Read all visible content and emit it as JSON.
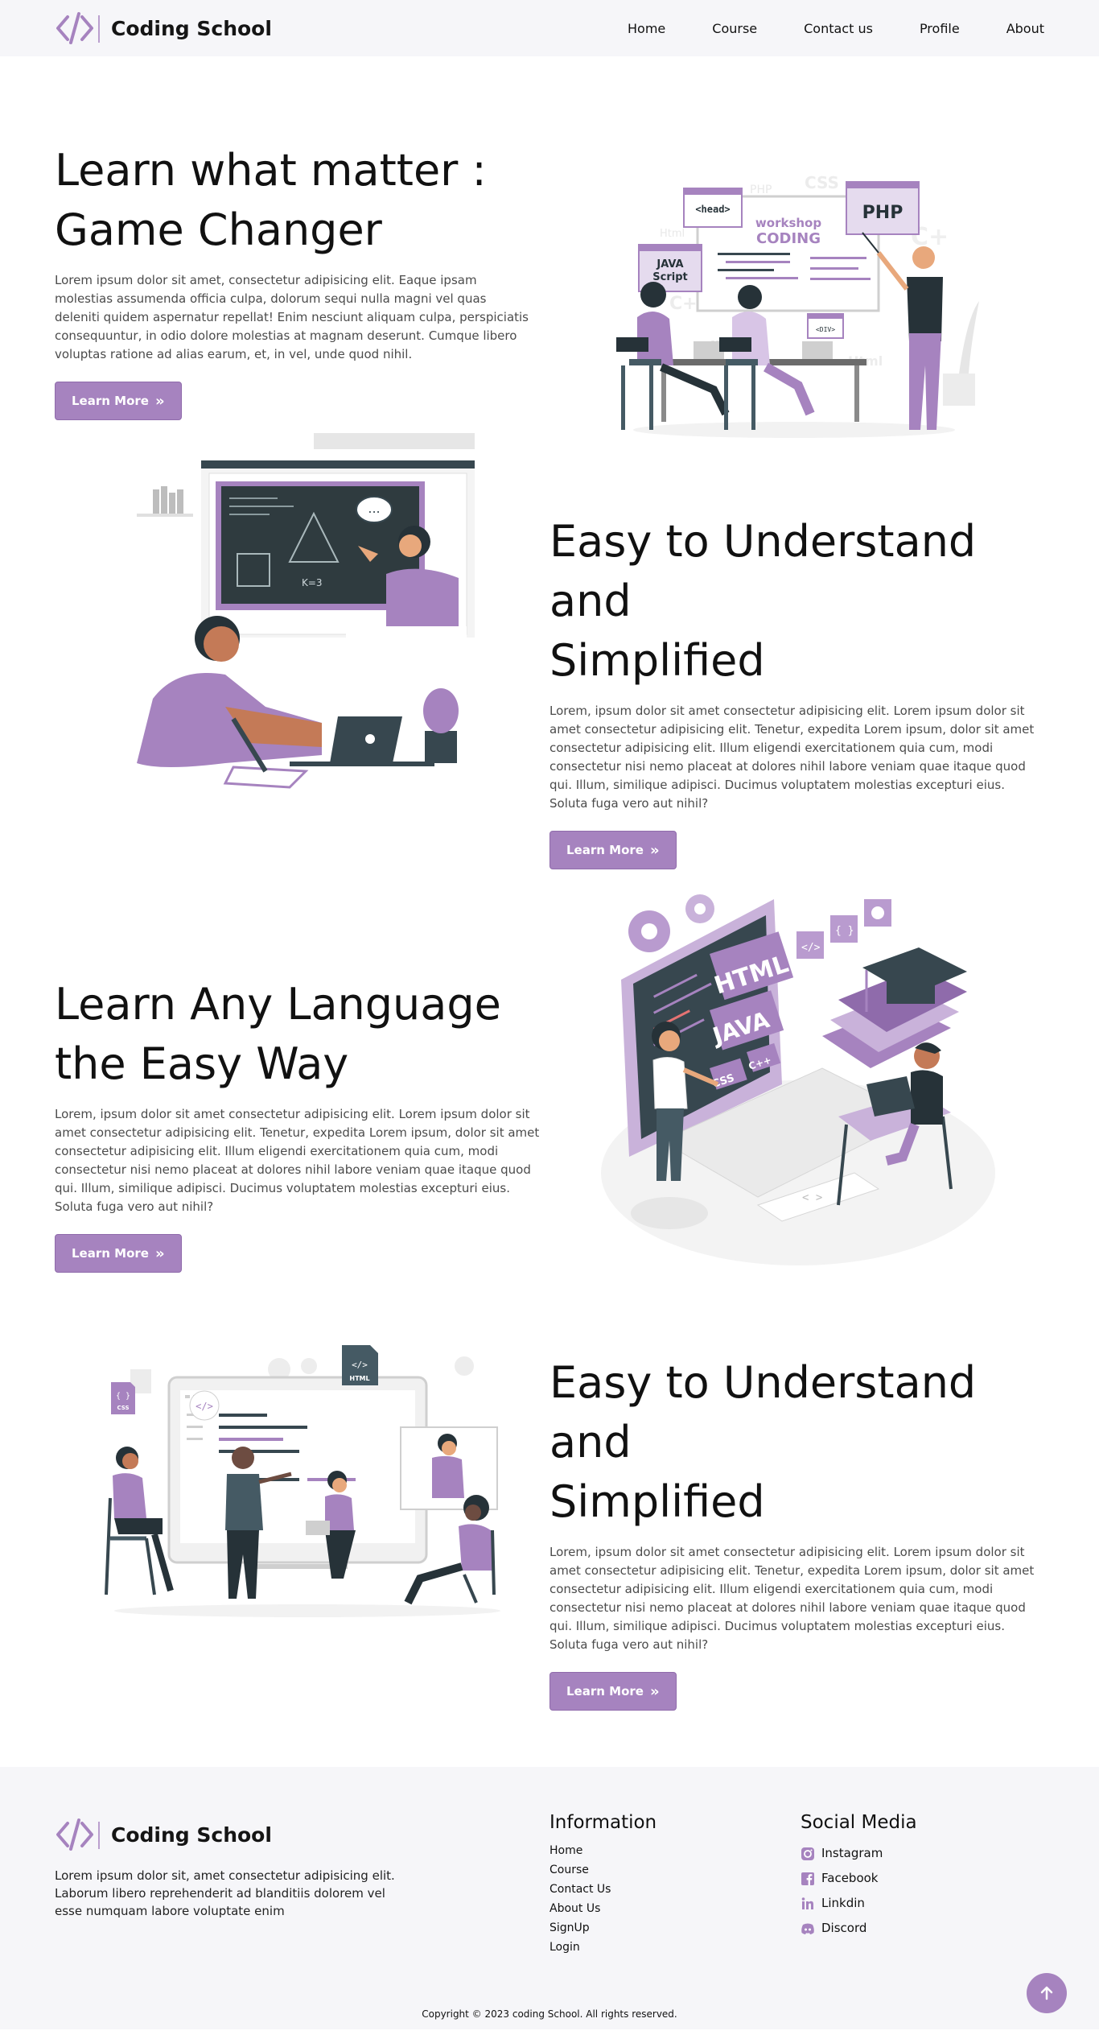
{
  "brand": {
    "name": "Coding School",
    "logo_icon": "code-brackets-icon"
  },
  "nav": {
    "items": [
      "Home",
      "Course",
      "Contact us",
      "Profile",
      "About"
    ]
  },
  "sections": [
    {
      "title_line1": "Learn what matter :",
      "title_line2": "Game Changer",
      "description": "Lorem ipsum dolor sit amet, consectetur adipisicing elit. Eaque ipsam molestias assumenda officia culpa, dolorum sequi nulla magni vel quas deleniti quidem aspernatur repellat! Enim nesciunt aliquam culpa, perspiciatis consequuntur, in odio dolore molestias at magnam deserunt. Cumque libero voluptas ratione ad alias earum, et, in vel, unde quod nihil.",
      "button": "Learn More",
      "illustration": {
        "head": "<head>",
        "php_small": "PHP",
        "css": "CSS",
        "html_small": "Html",
        "workshop_line1": "workshop",
        "workshop_line2": "CODING",
        "php": "PHP",
        "java_line1": "JAVA",
        "java_line2": "Script",
        "cplus": "C+",
        "cplus2": "C+",
        "css_small": "css",
        "div": "<DIV>",
        "html_right": "Html"
      }
    },
    {
      "title_line1": "Easy to Understand and",
      "title_line2": "Simplified",
      "description": "Lorem, ipsum dolor sit amet consectetur adipisicing elit. Lorem ipsum dolor sit amet consectetur adipisicing elit. Tenetur, expedita Lorem ipsum, dolor sit amet consectetur adipisicing elit. Illum eligendi exercitationem quia cum, modi consectetur nisi nemo placeat at dolores nihil labore veniam quae itaque quod qui. Illum, similique adipisci. Ducimus voluptatem molestias excepturi eius. Soluta fuga vero aut nihil?",
      "button": "Learn More",
      "illustration": {
        "board_formula": "K=3",
        "speech": "..."
      }
    },
    {
      "title_line1": "Learn Any Language",
      "title_line2": "the Easy Way",
      "description": "Lorem, ipsum dolor sit amet consectetur adipisicing elit. Lorem ipsum dolor sit amet consectetur adipisicing elit. Tenetur, expedita Lorem ipsum, dolor sit amet consectetur adipisicing elit. Illum eligendi exercitationem quia cum, modi consectetur nisi nemo placeat at dolores nihil labore veniam quae itaque quod qui. Illum, similique adipisci. Ducimus voluptatem molestias excepturi eius. Soluta fuga vero aut nihil?",
      "button": "Learn More",
      "illustration": {
        "html": "HTML",
        "java": "JAVA",
        "css": "CSS",
        "cpp": "C++",
        "tag1": "</>",
        "tag2": "{ }",
        "kbd": "< >"
      }
    },
    {
      "title_line1": "Easy to Understand and",
      "title_line2": "Simplified",
      "description": "Lorem, ipsum dolor sit amet consectetur adipisicing elit. Lorem ipsum dolor sit amet consectetur adipisicing elit. Tenetur, expedita Lorem ipsum, dolor sit amet consectetur adipisicing elit. Illum eligendi exercitationem quia cum, modi consectetur nisi nemo placeat at dolores nihil labore veniam quae itaque quod qui. Illum, similique adipisci. Ducimus voluptatem molestias excepturi eius. Soluta fuga vero aut nihil?",
      "button": "Learn More",
      "illustration": {
        "html": "HTML",
        "html_tag": "</>",
        "css": "CSS",
        "css_tag": "{ }",
        "code_tag": "</>"
      }
    }
  ],
  "footer": {
    "description": "Lorem ipsum dolor sit, amet consectetur adipisicing elit. Laborum libero reprehenderit ad blanditiis dolorem vel esse numquam labore voluptate enim",
    "info_title": "Information",
    "info_links": [
      "Home",
      "Course",
      "Contact Us",
      "About Us",
      "SignUp",
      "Login"
    ],
    "social_title": "Social Media",
    "social": [
      {
        "label": "Instagram",
        "icon": "instagram-icon"
      },
      {
        "label": "Facebook",
        "icon": "facebook-icon"
      },
      {
        "label": "Linkdin",
        "icon": "linkedin-icon"
      },
      {
        "label": "Discord",
        "icon": "discord-icon"
      }
    ],
    "copyright": "Copyright © 2023 coding School. All rights reserved."
  },
  "colors": {
    "accent": "#a683bf",
    "accent_dark": "#8f6bab",
    "nav_bg": "#f6f6f9",
    "dark": "#37474f"
  }
}
